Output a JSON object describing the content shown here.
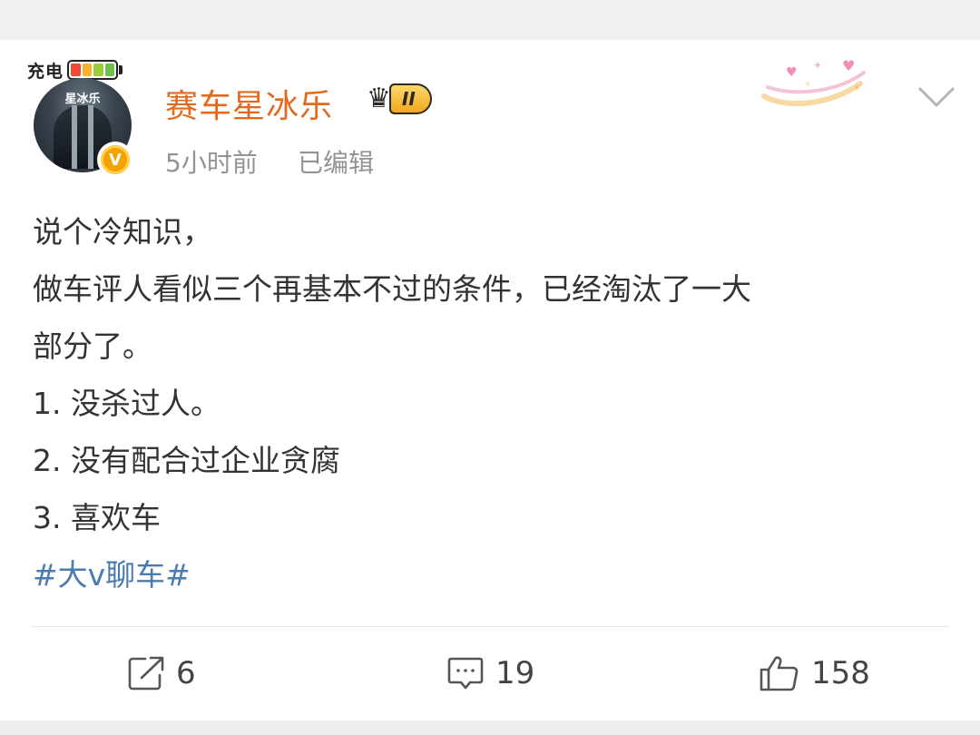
{
  "post": {
    "avatar_badge_text": "充电",
    "avatar_label": "星冰乐",
    "verified_mark": "V",
    "username": "赛车星冰乐",
    "vip_level": "II",
    "time": "5小时前",
    "edited": "已编辑",
    "lines": [
      "说个冷知识，",
      "做车评人看似三个再基本不过的条件，已经淘汰了一大",
      "部分了。",
      "1. 没杀过人。",
      "2. 没有配合过企业贪腐",
      "3. 喜欢车"
    ],
    "hashtag": "#大v聊车#"
  },
  "actions": {
    "share_count": "6",
    "comment_count": "19",
    "like_count": "158"
  },
  "icons": [
    "crown-icon",
    "chevron-down-icon",
    "share-icon",
    "comment-icon",
    "like-icon",
    "verified-icon",
    "battery-icon"
  ],
  "colors": {
    "username": "#e36a1d",
    "hashtag": "#4a7bb1",
    "meta_text": "#939393",
    "body_text": "#333333",
    "verified": "#f5a100"
  }
}
